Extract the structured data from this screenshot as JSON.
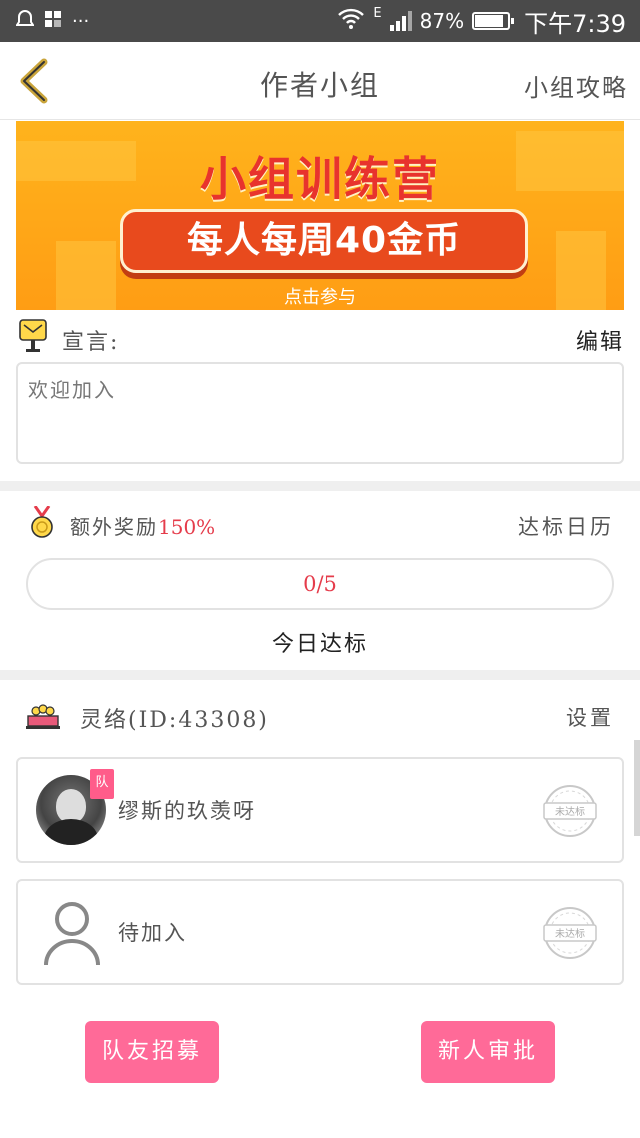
{
  "status_bar": {
    "battery": "87%",
    "battery_level": 0.87,
    "network": "E",
    "time": "下午7:39",
    "icons": [
      "notification-icon",
      "app-icon",
      "more-dots-icon",
      "wifi-icon",
      "signal-icon",
      "battery-icon"
    ]
  },
  "nav": {
    "title": "作者小组",
    "right_link": "小组攻略",
    "back_icon": "chevron-left-icon"
  },
  "banner": {
    "title": "小组训练营",
    "highlight": "每人每周40金币",
    "sub": "点击参与",
    "colors": {
      "bg": "#ffa51a",
      "title": "#e8332d",
      "pill": "#e84a1d"
    }
  },
  "declaration": {
    "label": "宣言:",
    "edit": "编辑",
    "text": "欢迎加入"
  },
  "reward": {
    "label_prefix": "额外奖励",
    "percent": "150%",
    "calendar": "达标日历",
    "progress_text": "0/5",
    "progress_fraction": 0,
    "today": "今日达标"
  },
  "group": {
    "name": "灵络(ID:43308)",
    "settings": "设置",
    "members": [
      {
        "name": "缪斯的玖羡呀",
        "badge": "队",
        "status": "未达标"
      },
      {
        "name": "待加入",
        "status": "未达标"
      }
    ]
  },
  "actions": {
    "recruit": "队友招募",
    "approve": "新人审批"
  },
  "colors": {
    "accent": "#ff6a98",
    "red_text": "#e53c4b"
  }
}
